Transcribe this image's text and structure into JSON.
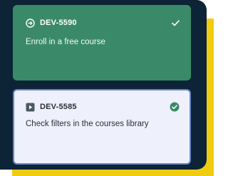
{
  "colors": {
    "panel": "#0c2436",
    "accent_shadow": "#f0cc10",
    "done_card": "#3a8a6a",
    "active_card_bg": "#eef0fb",
    "active_card_border": "#6a86c9",
    "check_badge": "#3a8a6a"
  },
  "cards": [
    {
      "id": "DEV-5590",
      "title": "Enroll in a free course",
      "type_icon": "enter-circle-icon",
      "status_icon": "checkmark-icon"
    },
    {
      "id": "DEV-5585",
      "title": "Check filters in the courses library",
      "type_icon": "play-square-icon",
      "status_icon": "check-circle-icon"
    }
  ]
}
